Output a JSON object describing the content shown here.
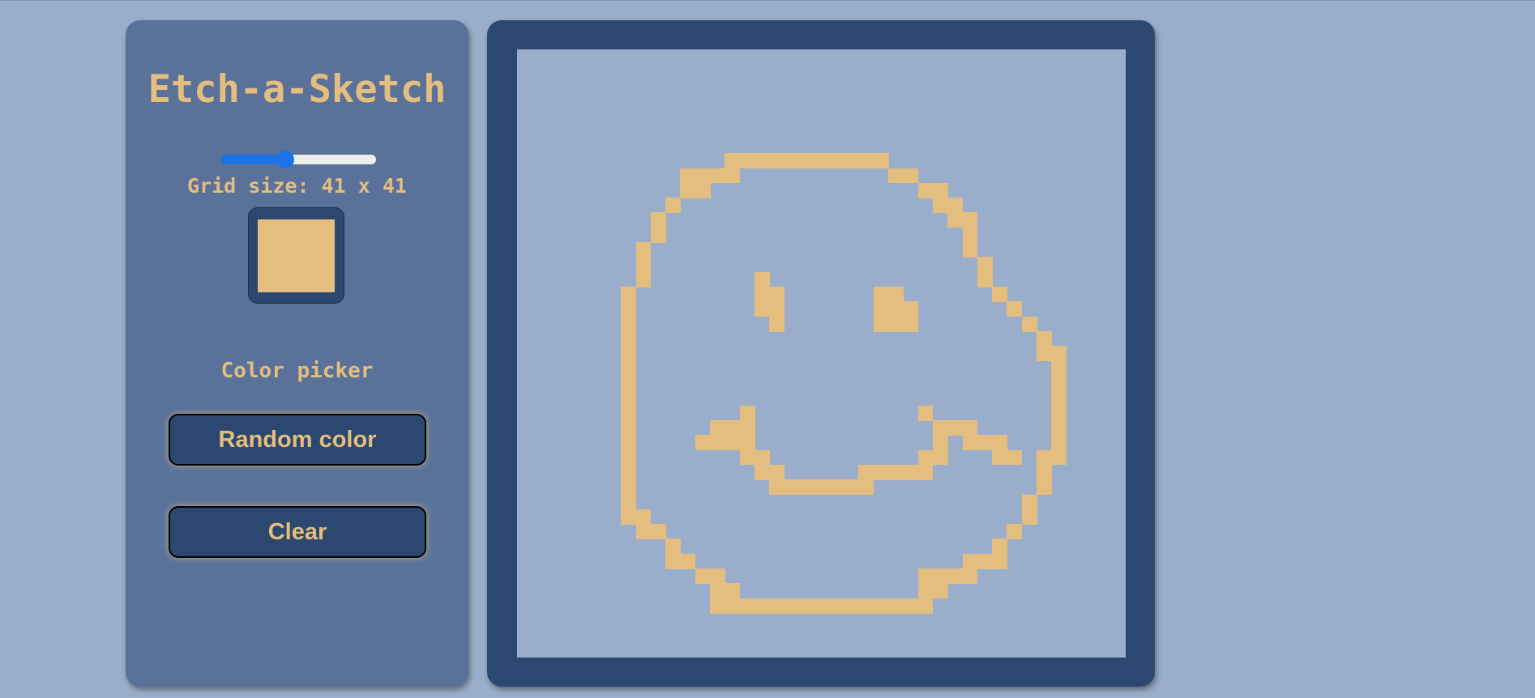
{
  "app": {
    "title": "Etch-a-Sketch"
  },
  "controls": {
    "slider_value": 41,
    "slider_min": 1,
    "slider_max": 100,
    "grid_size_label": "Grid size: 41 x 41",
    "color_picker_label": "Color picker",
    "selected_color": "#e4be7e",
    "random_button_label": "Random color",
    "clear_button_label": "Clear"
  },
  "colors": {
    "background": "#9aaecb",
    "panel": "#5a7299",
    "dark": "#2c4870",
    "accent": "#e4be7e",
    "slider_blue": "#1a73e8"
  },
  "grid": {
    "size": 41,
    "paint_color": "#e4be7e",
    "painted_cells": [
      [
        7,
        14
      ],
      [
        7,
        15
      ],
      [
        7,
        16
      ],
      [
        7,
        17
      ],
      [
        7,
        18
      ],
      [
        7,
        19
      ],
      [
        7,
        20
      ],
      [
        7,
        21
      ],
      [
        7,
        22
      ],
      [
        7,
        23
      ],
      [
        7,
        24
      ],
      [
        8,
        11
      ],
      [
        8,
        12
      ],
      [
        8,
        13
      ],
      [
        8,
        14
      ],
      [
        8,
        25
      ],
      [
        8,
        26
      ],
      [
        9,
        11
      ],
      [
        9,
        12
      ],
      [
        9,
        27
      ],
      [
        9,
        28
      ],
      [
        10,
        10
      ],
      [
        10,
        28
      ],
      [
        10,
        29
      ],
      [
        11,
        9
      ],
      [
        11,
        29
      ],
      [
        11,
        30
      ],
      [
        12,
        9
      ],
      [
        12,
        30
      ],
      [
        13,
        8
      ],
      [
        13,
        30
      ],
      [
        14,
        8
      ],
      [
        14,
        31
      ],
      [
        15,
        8
      ],
      [
        15,
        16
      ],
      [
        15,
        31
      ],
      [
        16,
        7
      ],
      [
        16,
        16
      ],
      [
        16,
        17
      ],
      [
        16,
        24
      ],
      [
        16,
        25
      ],
      [
        16,
        32
      ],
      [
        17,
        7
      ],
      [
        17,
        16
      ],
      [
        17,
        17
      ],
      [
        17,
        24
      ],
      [
        17,
        25
      ],
      [
        17,
        26
      ],
      [
        17,
        33
      ],
      [
        18,
        7
      ],
      [
        18,
        17
      ],
      [
        18,
        24
      ],
      [
        18,
        25
      ],
      [
        18,
        26
      ],
      [
        18,
        34
      ],
      [
        19,
        7
      ],
      [
        19,
        35
      ],
      [
        20,
        7
      ],
      [
        20,
        35
      ],
      [
        20,
        36
      ],
      [
        21,
        7
      ],
      [
        21,
        36
      ],
      [
        22,
        7
      ],
      [
        22,
        36
      ],
      [
        23,
        7
      ],
      [
        23,
        36
      ],
      [
        24,
        7
      ],
      [
        24,
        15
      ],
      [
        24,
        27
      ],
      [
        24,
        36
      ],
      [
        25,
        7
      ],
      [
        25,
        13
      ],
      [
        25,
        14
      ],
      [
        25,
        15
      ],
      [
        25,
        28
      ],
      [
        25,
        29
      ],
      [
        25,
        30
      ],
      [
        25,
        36
      ],
      [
        26,
        7
      ],
      [
        26,
        12
      ],
      [
        26,
        13
      ],
      [
        26,
        14
      ],
      [
        26,
        15
      ],
      [
        26,
        28
      ],
      [
        26,
        30
      ],
      [
        26,
        31
      ],
      [
        26,
        32
      ],
      [
        26,
        36
      ],
      [
        27,
        7
      ],
      [
        27,
        15
      ],
      [
        27,
        16
      ],
      [
        27,
        27
      ],
      [
        27,
        28
      ],
      [
        27,
        32
      ],
      [
        27,
        33
      ],
      [
        27,
        35
      ],
      [
        27,
        36
      ],
      [
        28,
        7
      ],
      [
        28,
        16
      ],
      [
        28,
        17
      ],
      [
        28,
        23
      ],
      [
        28,
        24
      ],
      [
        28,
        25
      ],
      [
        28,
        26
      ],
      [
        28,
        27
      ],
      [
        28,
        35
      ],
      [
        29,
        7
      ],
      [
        29,
        17
      ],
      [
        29,
        18
      ],
      [
        29,
        19
      ],
      [
        29,
        20
      ],
      [
        29,
        21
      ],
      [
        29,
        22
      ],
      [
        29,
        23
      ],
      [
        29,
        35
      ],
      [
        30,
        7
      ],
      [
        30,
        34
      ],
      [
        31,
        7
      ],
      [
        31,
        8
      ],
      [
        31,
        34
      ],
      [
        32,
        8
      ],
      [
        32,
        9
      ],
      [
        32,
        33
      ],
      [
        33,
        10
      ],
      [
        33,
        32
      ],
      [
        34,
        10
      ],
      [
        34,
        11
      ],
      [
        34,
        30
      ],
      [
        34,
        31
      ],
      [
        34,
        32
      ],
      [
        35,
        12
      ],
      [
        35,
        13
      ],
      [
        35,
        27
      ],
      [
        35,
        28
      ],
      [
        35,
        29
      ],
      [
        35,
        30
      ],
      [
        36,
        13
      ],
      [
        36,
        14
      ],
      [
        36,
        27
      ],
      [
        36,
        28
      ],
      [
        37,
        13
      ],
      [
        37,
        14
      ],
      [
        37,
        15
      ],
      [
        37,
        16
      ],
      [
        37,
        17
      ],
      [
        37,
        18
      ],
      [
        37,
        19
      ],
      [
        37,
        20
      ],
      [
        37,
        21
      ],
      [
        37,
        22
      ],
      [
        37,
        23
      ],
      [
        37,
        24
      ],
      [
        37,
        25
      ],
      [
        37,
        26
      ],
      [
        37,
        27
      ]
    ]
  }
}
